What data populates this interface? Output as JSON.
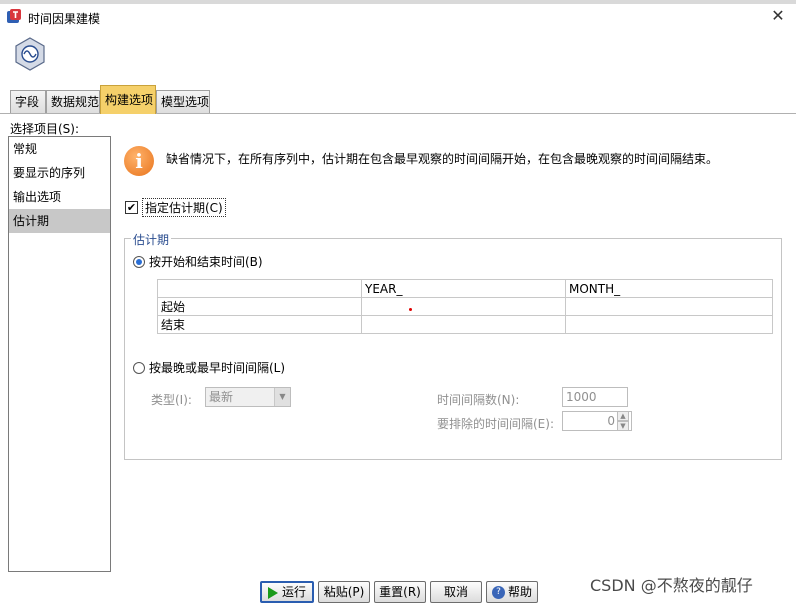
{
  "window": {
    "title": "时间因果建模",
    "close_glyph": "✕"
  },
  "tabs": [
    "字段",
    "数据规范",
    "构建选项",
    "模型选项"
  ],
  "sidebar": {
    "label": "选择项目(S):",
    "items": [
      "常规",
      "要显示的序列",
      "输出选项",
      "估计期"
    ]
  },
  "info": {
    "icon_glyph": "i",
    "text": "缺省情况下，在所有序列中，估计期在包含最早观察的时间间隔开始，在包含最晚观察的时间间隔结束。"
  },
  "specify_period": {
    "label": "指定估计期(C)",
    "checked": true,
    "check_glyph": "✔"
  },
  "estimation": {
    "group_title": "估计期",
    "start_end_radio": "按开始和结束时间(B)",
    "table": {
      "columns": [
        "",
        "YEAR_",
        "MONTH_"
      ],
      "rows": [
        {
          "label": "起始",
          "year": "",
          "month": ""
        },
        {
          "label": "结束",
          "year": "",
          "month": ""
        }
      ]
    },
    "interval_radio": "按最晚或最早时间间隔(L)",
    "type_label": "类型(I):",
    "type_value": "最新",
    "interval_count_label": "时间间隔数(N):",
    "interval_count_value": "1000",
    "exclude_label": "要排除的时间间隔(E):",
    "exclude_value": "0"
  },
  "buttons": {
    "run": "运行",
    "paste": "粘贴(P)",
    "reset": "重置(R)",
    "cancel": "取消",
    "help": "帮助",
    "help_glyph": "?"
  },
  "watermark": "CSDN @不熬夜的靓仔"
}
